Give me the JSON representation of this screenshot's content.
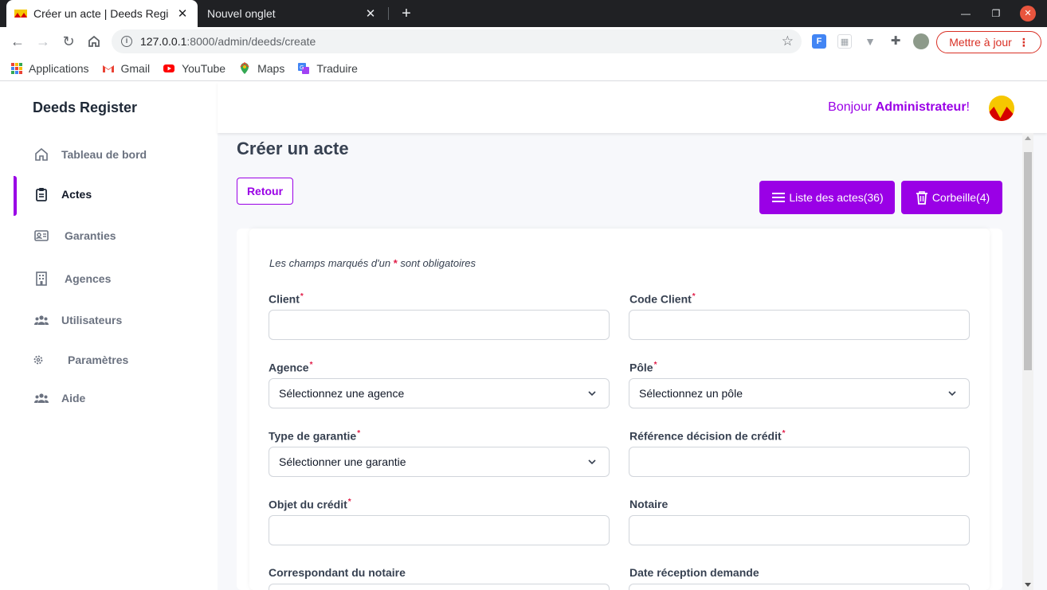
{
  "browser": {
    "tabs": [
      {
        "title": "Créer un acte | Deeds Regi",
        "active": true
      },
      {
        "title": "Nouvel onglet",
        "active": false
      }
    ],
    "url_host": "127.0.0.1",
    "url_rest": ":8000/admin/deeds/create",
    "update_label": "Mettre à jour",
    "bookmarks": [
      {
        "label": "Applications",
        "icon": "apps-grid-icon"
      },
      {
        "label": "Gmail",
        "icon": "gmail-icon"
      },
      {
        "label": "YouTube",
        "icon": "youtube-icon"
      },
      {
        "label": "Maps",
        "icon": "maps-icon"
      },
      {
        "label": "Traduire",
        "icon": "translate-icon"
      }
    ]
  },
  "app": {
    "brand": "Deeds Register",
    "greeting_prefix": "Bonjour ",
    "greeting_name": "Administrateur",
    "greeting_suffix": "!",
    "accent_color": "#9a00e6",
    "nav": [
      {
        "label": "Tableau de bord",
        "icon": "home-icon",
        "active": false
      },
      {
        "label": "Actes",
        "icon": "clipboard-icon",
        "active": true
      },
      {
        "label": "Garanties",
        "icon": "id-card-icon",
        "active": false
      },
      {
        "label": "Agences",
        "icon": "building-icon",
        "active": false
      },
      {
        "label": "Utilisateurs",
        "icon": "users-icon",
        "active": false
      },
      {
        "label": "Paramètres",
        "icon": "gear-icon",
        "active": false
      },
      {
        "label": "Aide",
        "icon": "users-icon",
        "active": false
      }
    ]
  },
  "page": {
    "title": "Créer un acte",
    "back_label": "Retour",
    "list_label": "Liste des actes(36)",
    "trash_label": "Corbeille(4)",
    "note_prefix": "Les champs marqués d'un ",
    "note_star": "*",
    "note_suffix": " sont obligatoires"
  },
  "form": {
    "fields": [
      {
        "label": "Client",
        "required": true,
        "type": "text",
        "value": ""
      },
      {
        "label": "Code Client",
        "required": true,
        "type": "text",
        "value": ""
      },
      {
        "label": "Agence",
        "required": true,
        "type": "select",
        "value": "Sélectionnez une agence"
      },
      {
        "label": "Pôle",
        "required": true,
        "type": "select",
        "value": "Sélectionnez un pôle"
      },
      {
        "label": "Type de garantie",
        "required": true,
        "type": "select",
        "value": "Sélectionner une garantie"
      },
      {
        "label": "Référence décision de crédit",
        "required": true,
        "type": "text",
        "value": ""
      },
      {
        "label": "Objet du crédit",
        "required": true,
        "type": "text",
        "value": ""
      },
      {
        "label": "Notaire",
        "required": false,
        "type": "text",
        "value": ""
      },
      {
        "label": "Correspondant du notaire",
        "required": false,
        "type": "text",
        "value": ""
      },
      {
        "label": "Date réception demande",
        "required": false,
        "type": "text",
        "value": ""
      }
    ],
    "required_marker": "*"
  }
}
